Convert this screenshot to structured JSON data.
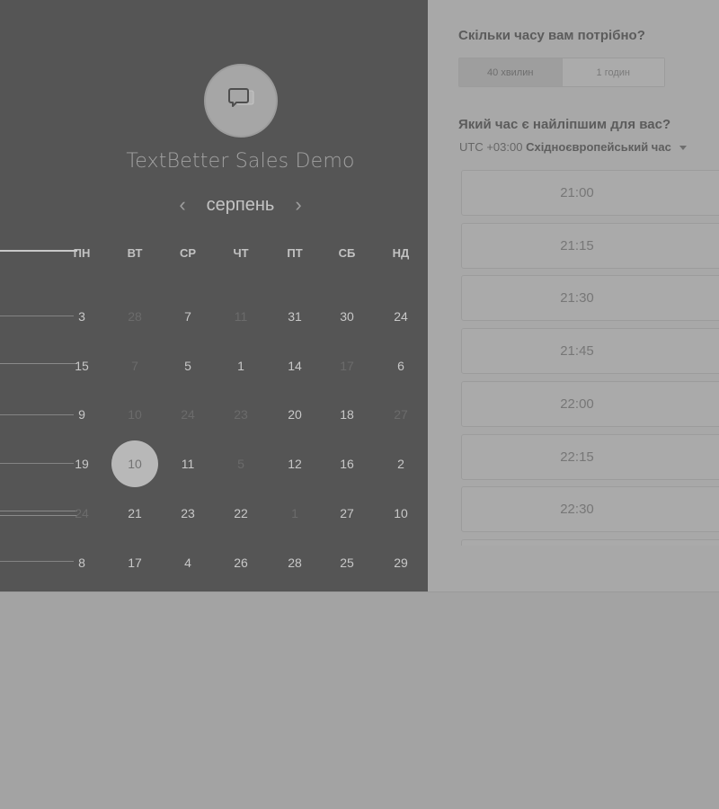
{
  "event": {
    "title": "TextBetter Sales Demo",
    "icon": "chat-bubble-icon"
  },
  "calendar": {
    "month": "серпень",
    "prev_icon": "chevron-left-icon",
    "next_icon": "chevron-right-icon",
    "weekdays": [
      "ПН",
      "ВТ",
      "СР",
      "ЧТ",
      "ПТ",
      "СБ",
      "НД"
    ],
    "weeks": [
      [
        {
          "day": "3"
        },
        {
          "day": "28",
          "muted": true
        },
        {
          "day": "7"
        },
        {
          "day": "11",
          "muted": true
        },
        {
          "day": "31"
        },
        {
          "day": "30"
        },
        {
          "day": "24"
        }
      ],
      [
        {
          "day": "15"
        },
        {
          "day": "7",
          "muted": true
        },
        {
          "day": "5"
        },
        {
          "day": "1"
        },
        {
          "day": "14"
        },
        {
          "day": "17",
          "muted": true
        },
        {
          "day": "6"
        }
      ],
      [
        {
          "day": "9"
        },
        {
          "day": "10",
          "muted": true
        },
        {
          "day": "24",
          "muted": true
        },
        {
          "day": "23",
          "muted": true
        },
        {
          "day": "20"
        },
        {
          "day": "18"
        },
        {
          "day": "27",
          "muted": true
        }
      ],
      [
        {
          "day": "19"
        },
        {
          "day": "10",
          "selected": true
        },
        {
          "day": "11"
        },
        {
          "day": "5",
          "muted": true
        },
        {
          "day": "12"
        },
        {
          "day": "16"
        },
        {
          "day": "2"
        }
      ],
      [
        {
          "day": "24",
          "muted": true
        },
        {
          "day": "21"
        },
        {
          "day": "23"
        },
        {
          "day": "22"
        },
        {
          "day": "1",
          "muted": true
        },
        {
          "day": "27"
        },
        {
          "day": "10"
        }
      ],
      [
        {
          "day": "8"
        },
        {
          "day": "17"
        },
        {
          "day": "4"
        },
        {
          "day": "26"
        },
        {
          "day": "28"
        },
        {
          "day": "25"
        },
        {
          "day": "29"
        }
      ]
    ]
  },
  "booking": {
    "duration_question": "Скільки часу вам потрібно?",
    "durations": [
      {
        "label": "40 хвилин",
        "active": true
      },
      {
        "label": "1 годин",
        "active": false
      }
    ],
    "time_question": "Який час є найліпшим для вас?",
    "timezone_offset": "UTC +03:00",
    "timezone_name": "Східноєвропейський час",
    "slots": [
      "21:00",
      "21:15",
      "21:30",
      "21:45",
      "22:00",
      "22:15",
      "22:30",
      ""
    ]
  },
  "colors": {
    "left_panel": "#555555",
    "right_panel": "#a8a8a8",
    "selected_day": "#b8b8b8"
  }
}
